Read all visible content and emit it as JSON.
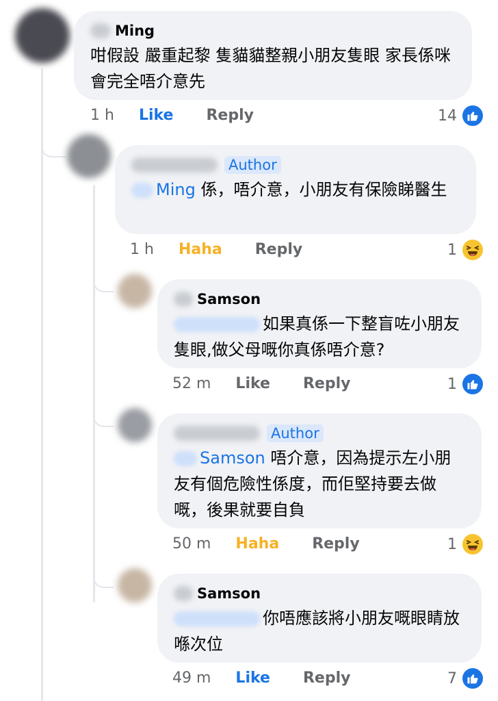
{
  "comments": [
    {
      "name": "Ming",
      "text": "咁假設 嚴重起黎 隻貓貓整親小朋友隻眼 家長係咪會完全唔介意先",
      "time": "1 h",
      "action": "Like",
      "reply": "Reply",
      "reaction_count": "14",
      "reaction_icon": "like-icon"
    },
    {
      "author_badge": "Author",
      "mention": "Ming",
      "text": "係，唔介意，小朋友有保險睇醫生",
      "time": "1 h",
      "action": "Haha",
      "reply": "Reply",
      "reaction_count": "1",
      "reaction_icon": "haha-icon"
    },
    {
      "name": "Samson",
      "text": "如果真係一下整盲咗小朋友隻眼,做父母嘅你真係唔介意?",
      "time": "52 m",
      "action": "Like",
      "reply": "Reply",
      "reaction_count": "1",
      "reaction_icon": "like-icon"
    },
    {
      "author_badge": "Author",
      "mention": "Samson",
      "text": "唔介意，因為提示左小朋友有個危險性係度，而佢堅持要去做嘅，後果就要自負",
      "time": "50 m",
      "action": "Haha",
      "reply": "Reply",
      "reaction_count": "1",
      "reaction_icon": "haha-icon"
    },
    {
      "name": "Samson",
      "text": "你唔應該將小朋友嘅眼睛放喺次位",
      "time": "49 m",
      "action": "Like",
      "reply": "Reply",
      "reaction_count": "7",
      "reaction_icon": "like-icon"
    }
  ],
  "colors": {
    "accent": "#1b74e4",
    "haha": "#f7b125",
    "bubble": "#f0f2f5",
    "meta": "#65676b"
  }
}
